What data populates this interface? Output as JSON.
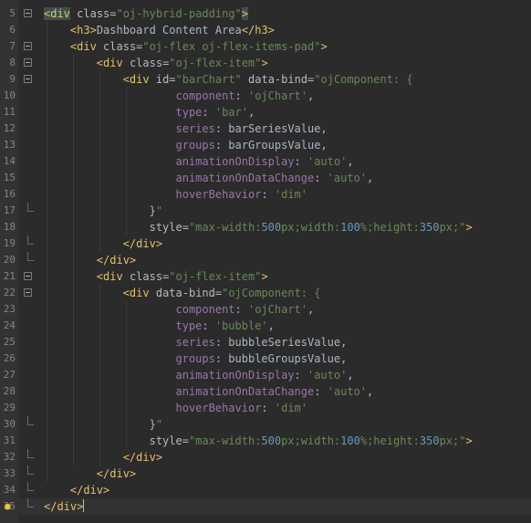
{
  "editor": {
    "language": "html",
    "caret_line": 35,
    "lines": [
      {
        "num": "5",
        "tokens": [
          [
            "tag",
            "<div"
          ],
          [
            "txt",
            " "
          ],
          [
            "attr",
            "class"
          ],
          [
            "txt",
            "="
          ],
          [
            "val",
            "\"oj-hybrid-padding\""
          ],
          [
            "tag",
            ">"
          ]
        ]
      },
      {
        "num": "6",
        "tokens": [
          [
            "txt",
            "    "
          ],
          [
            "tag",
            "<h3>"
          ],
          [
            "txt",
            "Dashboard Content Area"
          ],
          [
            "tag",
            "</h3>"
          ]
        ]
      },
      {
        "num": "7",
        "tokens": [
          [
            "txt",
            "    "
          ],
          [
            "tag",
            "<div"
          ],
          [
            "txt",
            " "
          ],
          [
            "attr",
            "class"
          ],
          [
            "txt",
            "="
          ],
          [
            "val",
            "\"oj-flex oj-flex-items-pad\""
          ],
          [
            "tag",
            ">"
          ]
        ]
      },
      {
        "num": "8",
        "tokens": [
          [
            "txt",
            "        "
          ],
          [
            "tag",
            "<div"
          ],
          [
            "txt",
            " "
          ],
          [
            "attr",
            "class"
          ],
          [
            "txt",
            "="
          ],
          [
            "val",
            "\"oj-flex-item\""
          ],
          [
            "tag",
            ">"
          ]
        ]
      },
      {
        "num": "9",
        "tokens": [
          [
            "txt",
            "            "
          ],
          [
            "tag",
            "<div"
          ],
          [
            "txt",
            " "
          ],
          [
            "attr",
            "id"
          ],
          [
            "txt",
            "="
          ],
          [
            "val",
            "\"barChart\""
          ],
          [
            "txt",
            " "
          ],
          [
            "attr",
            "data-bind"
          ],
          [
            "txt",
            "="
          ],
          [
            "val",
            "\"ojComponent: {"
          ]
        ]
      },
      {
        "num": "10",
        "tokens": [
          [
            "txt",
            "                    "
          ],
          [
            "prop",
            "component"
          ],
          [
            "txt",
            ": "
          ],
          [
            "str",
            "'ojChart'"
          ],
          [
            "txt",
            ","
          ]
        ]
      },
      {
        "num": "11",
        "tokens": [
          [
            "txt",
            "                    "
          ],
          [
            "prop",
            "type"
          ],
          [
            "txt",
            ": "
          ],
          [
            "str",
            "'bar'"
          ],
          [
            "txt",
            ","
          ]
        ]
      },
      {
        "num": "12",
        "tokens": [
          [
            "txt",
            "                    "
          ],
          [
            "prop",
            "series"
          ],
          [
            "txt",
            ": barSeriesValue,"
          ]
        ]
      },
      {
        "num": "13",
        "tokens": [
          [
            "txt",
            "                    "
          ],
          [
            "prop",
            "groups"
          ],
          [
            "txt",
            ": barGroupsValue,"
          ]
        ]
      },
      {
        "num": "14",
        "tokens": [
          [
            "txt",
            "                    "
          ],
          [
            "prop",
            "animationOnDisplay"
          ],
          [
            "txt",
            ": "
          ],
          [
            "str",
            "'auto'"
          ],
          [
            "txt",
            ","
          ]
        ]
      },
      {
        "num": "15",
        "tokens": [
          [
            "txt",
            "                    "
          ],
          [
            "prop",
            "animationOnDataChange"
          ],
          [
            "txt",
            ": "
          ],
          [
            "str",
            "'auto'"
          ],
          [
            "txt",
            ","
          ]
        ]
      },
      {
        "num": "16",
        "tokens": [
          [
            "txt",
            "                    "
          ],
          [
            "prop",
            "hoverBehavior"
          ],
          [
            "txt",
            ": "
          ],
          [
            "str",
            "'dim'"
          ]
        ]
      },
      {
        "num": "17",
        "tokens": [
          [
            "txt",
            "                "
          ],
          [
            "txt",
            "}"
          ],
          [
            "val",
            "\""
          ]
        ]
      },
      {
        "num": "18",
        "tokens": [
          [
            "txt",
            "                "
          ],
          [
            "attr",
            "style"
          ],
          [
            "txt",
            "="
          ],
          [
            "val",
            "\"max-width:"
          ],
          [
            "num",
            "500"
          ],
          [
            "val",
            "px;width:"
          ],
          [
            "num",
            "100"
          ],
          [
            "val",
            "%;height:"
          ],
          [
            "num",
            "350"
          ],
          [
            "val",
            "px;\""
          ],
          [
            "tag",
            ">"
          ]
        ]
      },
      {
        "num": "19",
        "tokens": [
          [
            "txt",
            "            "
          ],
          [
            "tag",
            "</div>"
          ]
        ]
      },
      {
        "num": "20",
        "tokens": [
          [
            "txt",
            "        "
          ],
          [
            "tag",
            "</div>"
          ]
        ]
      },
      {
        "num": "21",
        "tokens": [
          [
            "txt",
            "        "
          ],
          [
            "tag",
            "<div"
          ],
          [
            "txt",
            " "
          ],
          [
            "attr",
            "class"
          ],
          [
            "txt",
            "="
          ],
          [
            "val",
            "\"oj-flex-item\""
          ],
          [
            "tag",
            ">"
          ]
        ]
      },
      {
        "num": "22",
        "tokens": [
          [
            "txt",
            "            "
          ],
          [
            "tag",
            "<div"
          ],
          [
            "txt",
            " "
          ],
          [
            "attr",
            "data-bind"
          ],
          [
            "txt",
            "="
          ],
          [
            "val",
            "\"ojComponent: {"
          ]
        ]
      },
      {
        "num": "23",
        "tokens": [
          [
            "txt",
            "                    "
          ],
          [
            "prop",
            "component"
          ],
          [
            "txt",
            ": "
          ],
          [
            "str",
            "'ojChart'"
          ],
          [
            "txt",
            ","
          ]
        ]
      },
      {
        "num": "24",
        "tokens": [
          [
            "txt",
            "                    "
          ],
          [
            "prop",
            "type"
          ],
          [
            "txt",
            ": "
          ],
          [
            "str",
            "'bubble'"
          ],
          [
            "txt",
            ","
          ]
        ]
      },
      {
        "num": "25",
        "tokens": [
          [
            "txt",
            "                    "
          ],
          [
            "prop",
            "series"
          ],
          [
            "txt",
            ": bubbleSeriesValue,"
          ]
        ]
      },
      {
        "num": "26",
        "tokens": [
          [
            "txt",
            "                    "
          ],
          [
            "prop",
            "groups"
          ],
          [
            "txt",
            ": bubbleGroupsValue,"
          ]
        ]
      },
      {
        "num": "27",
        "tokens": [
          [
            "txt",
            "                    "
          ],
          [
            "prop",
            "animationOnDisplay"
          ],
          [
            "txt",
            ": "
          ],
          [
            "str",
            "'auto'"
          ],
          [
            "txt",
            ","
          ]
        ]
      },
      {
        "num": "28",
        "tokens": [
          [
            "txt",
            "                    "
          ],
          [
            "prop",
            "animationOnDataChange"
          ],
          [
            "txt",
            ": "
          ],
          [
            "str",
            "'auto'"
          ],
          [
            "txt",
            ","
          ]
        ]
      },
      {
        "num": "29",
        "tokens": [
          [
            "txt",
            "                    "
          ],
          [
            "prop",
            "hoverBehavior"
          ],
          [
            "txt",
            ": "
          ],
          [
            "str",
            "'dim'"
          ]
        ]
      },
      {
        "num": "30",
        "tokens": [
          [
            "txt",
            "                "
          ],
          [
            "txt",
            "}"
          ],
          [
            "val",
            "\""
          ]
        ]
      },
      {
        "num": "31",
        "tokens": [
          [
            "txt",
            "                "
          ],
          [
            "attr",
            "style"
          ],
          [
            "txt",
            "="
          ],
          [
            "val",
            "\"max-width:"
          ],
          [
            "num",
            "500"
          ],
          [
            "val",
            "px;width:"
          ],
          [
            "num",
            "100"
          ],
          [
            "val",
            "%;height:"
          ],
          [
            "num",
            "350"
          ],
          [
            "val",
            "px;\""
          ],
          [
            "tag",
            ">"
          ]
        ]
      },
      {
        "num": "32",
        "tokens": [
          [
            "txt",
            "            "
          ],
          [
            "tag",
            "</div>"
          ]
        ]
      },
      {
        "num": "33",
        "tokens": [
          [
            "txt",
            "        "
          ],
          [
            "tag",
            "</div>"
          ]
        ]
      },
      {
        "num": "34",
        "tokens": [
          [
            "txt",
            "    "
          ],
          [
            "tag",
            "</div>"
          ]
        ]
      },
      {
        "num": "35",
        "tokens": [
          [
            "tag",
            "</div>"
          ]
        ]
      }
    ],
    "folds_open": [
      "5",
      "7",
      "8",
      "9",
      "21",
      "22"
    ],
    "folds_close": [
      "17",
      "19",
      "20",
      "30",
      "32",
      "33",
      "34",
      "35"
    ],
    "gutter_icons": {
      "35": "lightbulb-icon"
    },
    "colors": {
      "background": "#2b2b2b",
      "gutter": "#313335",
      "tag": "#e8bf6a",
      "attribute": "#bababa",
      "string": "#6a8759",
      "property": "#9876aa",
      "number": "#6897bb",
      "text": "#a9b7c6"
    }
  }
}
